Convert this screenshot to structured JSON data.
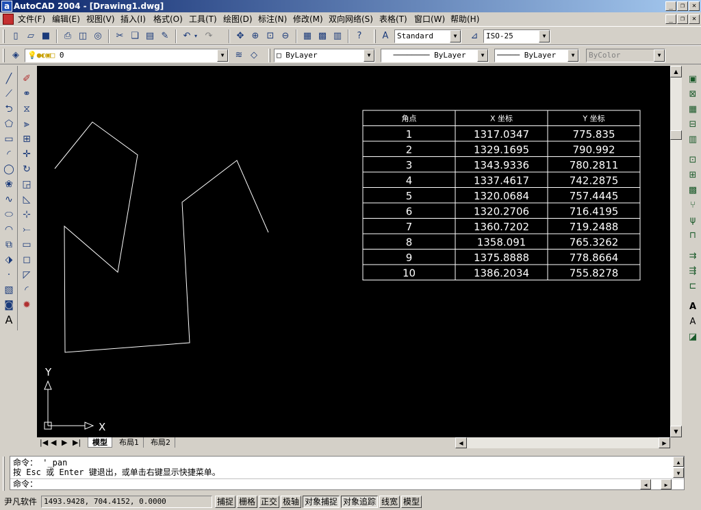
{
  "window": {
    "title": "AutoCAD 2004 - [Drawing1.dwg]",
    "app_icon_letter": "a",
    "minimize": "_",
    "restore": "❐",
    "close": "✕"
  },
  "menu": [
    "文件(F)",
    "编辑(E)",
    "视图(V)",
    "插入(I)",
    "格式(O)",
    "工具(T)",
    "绘图(D)",
    "标注(N)",
    "修改(M)",
    "双向网络(S)",
    "表格(T)",
    "窗口(W)",
    "帮助(H)"
  ],
  "toolbar": {
    "text_style": "Standard",
    "dim_style": "ISO-25",
    "layer": "0",
    "color": "ByLayer",
    "linetype": "ByLayer",
    "lineweight": "ByLayer",
    "plotstyle": "ByColor"
  },
  "table": {
    "headers": [
      "角点",
      "X 坐标",
      "Y 坐标"
    ],
    "rows": [
      [
        "1",
        "1317.0347",
        "775.835"
      ],
      [
        "2",
        "1329.1695",
        "790.992"
      ],
      [
        "3",
        "1343.9336",
        "780.2811"
      ],
      [
        "4",
        "1337.4617",
        "742.2875"
      ],
      [
        "5",
        "1320.0684",
        "757.4445"
      ],
      [
        "6",
        "1320.2706",
        "716.4195"
      ],
      [
        "7",
        "1360.7202",
        "719.2488"
      ],
      [
        "8",
        "1358.091",
        "765.3262"
      ],
      [
        "9",
        "1375.8888",
        "778.8664"
      ],
      [
        "10",
        "1386.2034",
        "755.8278"
      ]
    ]
  },
  "ucs": {
    "x_label": "X",
    "y_label": "Y"
  },
  "tabs": [
    "模型",
    "布局1",
    "布局2"
  ],
  "command": {
    "line1": "命令： '_pan",
    "line2": "按 Esc 或 Enter 键退出，或单击右键显示快捷菜单。",
    "prompt": "命令："
  },
  "status": {
    "label": "尹凡软件",
    "coords": "1493.9428, 704.4152, 0.0000",
    "buttons": [
      "捕捉",
      "栅格",
      "正交",
      "极轴",
      "对象捕捉",
      "对象追踪",
      "线宽",
      "模型"
    ],
    "on": [
      false,
      false,
      false,
      false,
      true,
      true,
      false,
      false
    ]
  }
}
